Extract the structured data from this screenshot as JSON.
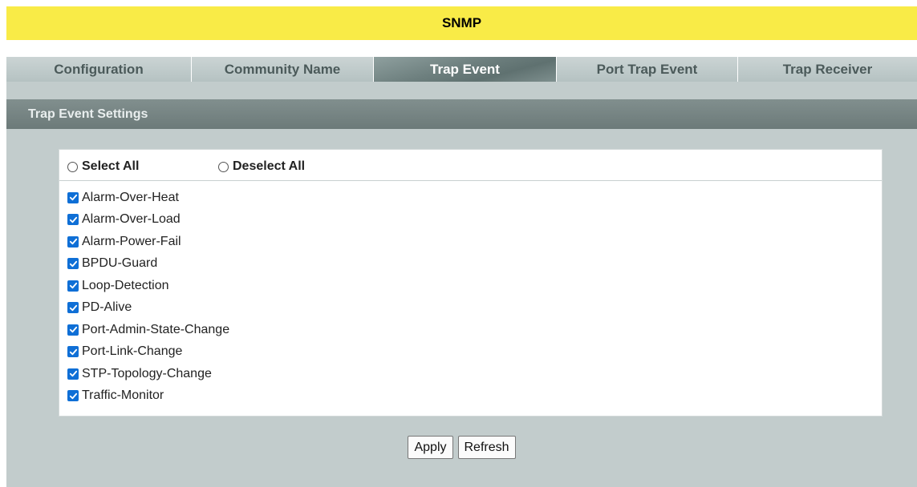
{
  "page_title": "SNMP",
  "tabs": [
    {
      "label": "Configuration",
      "active": false
    },
    {
      "label": "Community Name",
      "active": false
    },
    {
      "label": "Trap Event",
      "active": true
    },
    {
      "label": "Port Trap Event",
      "active": false
    },
    {
      "label": "Trap Receiver",
      "active": false
    }
  ],
  "section_title": "Trap Event Settings",
  "select_all_label": "Select All",
  "deselect_all_label": "Deselect All",
  "events": [
    {
      "label": "Alarm-Over-Heat",
      "checked": true
    },
    {
      "label": "Alarm-Over-Load",
      "checked": true
    },
    {
      "label": "Alarm-Power-Fail",
      "checked": true
    },
    {
      "label": "BPDU-Guard",
      "checked": true
    },
    {
      "label": "Loop-Detection",
      "checked": true
    },
    {
      "label": "PD-Alive",
      "checked": true
    },
    {
      "label": "Port-Admin-State-Change",
      "checked": true
    },
    {
      "label": "Port-Link-Change",
      "checked": true
    },
    {
      "label": "STP-Topology-Change",
      "checked": true
    },
    {
      "label": "Traffic-Monitor",
      "checked": true
    }
  ],
  "buttons": {
    "apply": "Apply",
    "refresh": "Refresh"
  },
  "colors": {
    "title_bar": "#f9eb47",
    "checkbox": "#0f6fd6",
    "active_tab": "#6d7f7e"
  }
}
